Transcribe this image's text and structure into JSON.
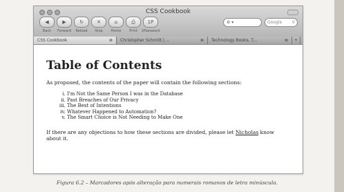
{
  "window": {
    "title": "CSS Cookbook",
    "toolbar": [
      {
        "label": "Back",
        "icon": "arrow-left-icon",
        "glyph": "◀"
      },
      {
        "label": "Forward",
        "icon": "arrow-right-icon",
        "glyph": "▶"
      },
      {
        "label": "Reload",
        "icon": "reload-icon",
        "glyph": "↻"
      },
      {
        "label": "Stop",
        "icon": "stop-icon",
        "glyph": "✕"
      },
      {
        "label": "Home",
        "icon": "home-icon",
        "glyph": "⌂"
      },
      {
        "label": "Print",
        "icon": "print-icon",
        "glyph": "⎙"
      },
      {
        "label": "1Password",
        "icon": "password-icon",
        "glyph": "1P"
      }
    ],
    "address": {
      "text": "⚙ ▾",
      "dropdown": "▾"
    },
    "search": {
      "placeholder": "Google",
      "icon": "search-icon"
    },
    "tabs": [
      {
        "label": "CSS Cookbook",
        "close": "⊗"
      },
      {
        "label": "Christopher Schmitt | ...",
        "close": "⊗"
      },
      {
        "label": "Technology Books, T...",
        "close": "⊗"
      }
    ],
    "new_tab": "+"
  },
  "document": {
    "heading": "Table of Contents",
    "intro": "As proposed, the contents of the paper will contain the following sections:",
    "sections": [
      "I'm Not the Same Person I was in the Database",
      "Past Breaches of Our Privacy",
      "The Best of Intentions",
      "Whatever Happened to Automation?",
      "The Smart Choice is Not Needing to Make One"
    ],
    "outro_before": "If there are any objections to how these sections are divided, please let ",
    "outro_link": "Nicholas",
    "outro_after": " know about it."
  },
  "caption": "Figura 6.2 – Marcadores após alteração para numerais romanos de letra minúscula."
}
